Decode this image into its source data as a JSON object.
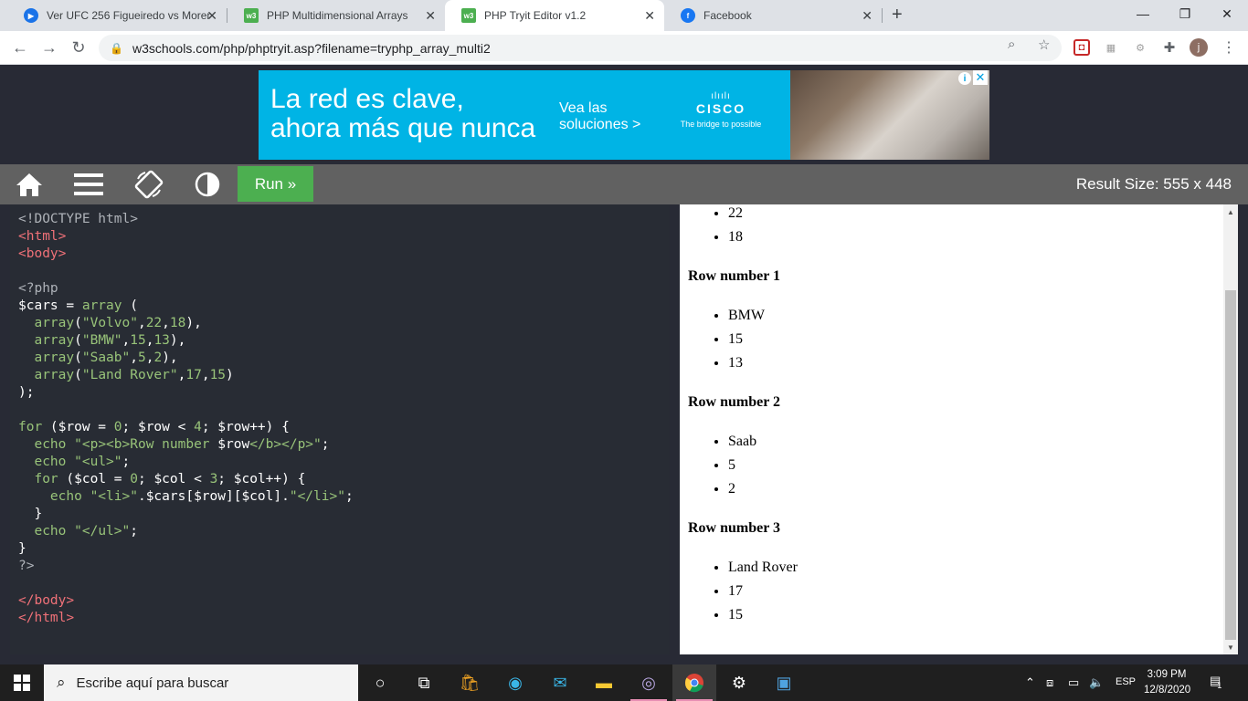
{
  "browser": {
    "tabs": [
      {
        "title": "Ver UFC 256 Figueiredo vs Moreno",
        "icon": "play-icon",
        "active": false
      },
      {
        "title": "PHP Multidimensional Arrays",
        "icon": "w3-icon",
        "active": false
      },
      {
        "title": "PHP Tryit Editor v1.2",
        "icon": "w3-icon",
        "active": true
      },
      {
        "title": "Facebook",
        "icon": "facebook-icon",
        "active": false
      }
    ],
    "new_tab": "+",
    "window": {
      "minimize": "—",
      "maximize": "❐",
      "close": "✕"
    },
    "url": "w3schools.com/php/phptryit.asp?filename=tryphp_array_multi2",
    "profile_initial": "j"
  },
  "ad": {
    "headline_line1": "La red es clave,",
    "headline_line2": "ahora más que nunca",
    "cta_line1": "Vea las",
    "cta_line2": "soluciones >",
    "brand": "CISCO",
    "brand_bars": "ılıılı",
    "tagline": "The bridge to possible",
    "info": "i",
    "close": "✕"
  },
  "w3toolbar": {
    "run_label": "Run »",
    "result_size_label": "Result Size:",
    "result_width": "555",
    "result_x": "x",
    "result_height": "448"
  },
  "result": {
    "partial_items": [
      "22",
      "18"
    ],
    "rows": [
      {
        "heading": "Row number 1",
        "items": [
          "BMW",
          "15",
          "13"
        ]
      },
      {
        "heading": "Row number 2",
        "items": [
          "Saab",
          "5",
          "2"
        ]
      },
      {
        "heading": "Row number 3",
        "items": [
          "Land Rover",
          "17",
          "15"
        ]
      }
    ]
  },
  "taskbar": {
    "search_placeholder": "Escribe aquí para buscar",
    "language": "ESP",
    "time": "3:09 PM",
    "date": "12/8/2020",
    "notifications": "1"
  },
  "colors": {
    "run_green": "#4caf50",
    "ad_blue": "#00b4e5",
    "editor_bg": "#282c34",
    "page_bg": "#282a35",
    "toolbar_gray": "#616161"
  }
}
